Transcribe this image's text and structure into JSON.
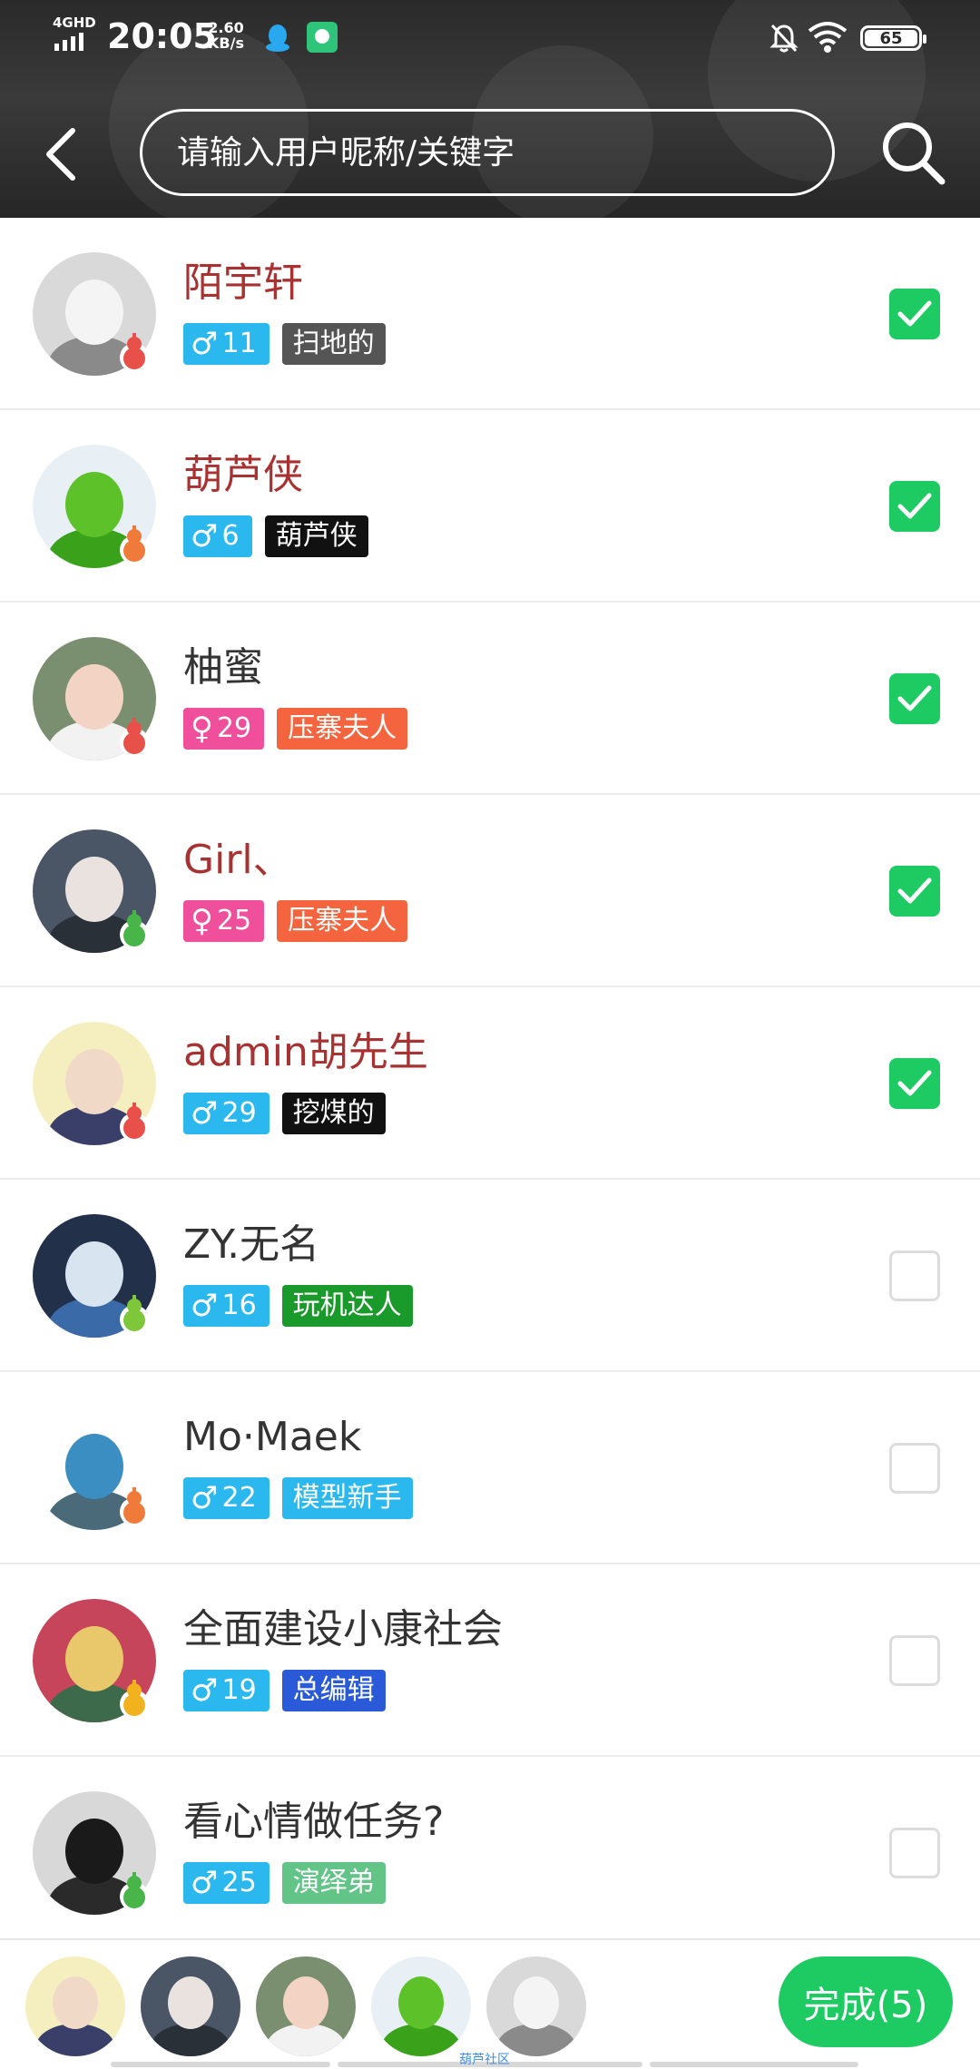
{
  "status_bar": {
    "network": "4GHD",
    "time": "20:05",
    "speed_value": "2.60",
    "speed_unit": "KB/s",
    "battery": "65",
    "icons": [
      "signal-icon",
      "qq-icon",
      "app-icon",
      "bell-muted-icon",
      "wifi-icon",
      "battery-icon"
    ]
  },
  "header": {
    "search_placeholder": "请输入用户昵称/关键字",
    "back_icon": "chevron-left-icon",
    "search_icon": "search-icon"
  },
  "colors": {
    "accent_green": "#1ecb63",
    "name_highlight": "#a83232",
    "name_normal": "#333333",
    "male_badge": "#2ab8ee",
    "female_badge": "#ef4f9b"
  },
  "users": [
    {
      "name": "陌宇轩",
      "gender": "♂",
      "age": "11",
      "title": "扫地的",
      "title_color": "#555555",
      "name_color": "#a83232",
      "checked": true,
      "gourd": "#e8504a",
      "avatar_bg": "#d9d9d9",
      "avatar_face": "#f4f4f4",
      "avatar_body": "#8a8a8a"
    },
    {
      "name": "葫芦侠",
      "gender": "♂",
      "age": "6",
      "title": "葫芦侠",
      "title_color": "#111111",
      "name_color": "#a83232",
      "checked": true,
      "gourd": "#f07a3a",
      "avatar_bg": "#e8f0f6",
      "avatar_face": "#5dc22a",
      "avatar_body": "#3aa11a"
    },
    {
      "name": "柚蜜",
      "gender": "♀",
      "age": "29",
      "title": "压寨夫人",
      "title_color": "#f4653f",
      "name_color": "#333333",
      "checked": true,
      "gourd": "#e8504a",
      "avatar_bg": "#7a8f70",
      "avatar_face": "#f3d3c4",
      "avatar_body": "#f2f2f2"
    },
    {
      "name": "Girl、",
      "gender": "♀",
      "age": "25",
      "title": "压寨夫人",
      "title_color": "#f4653f",
      "name_color": "#a83232",
      "checked": true,
      "gourd": "#48b548",
      "avatar_bg": "#4a5666",
      "avatar_face": "#e9e2df",
      "avatar_body": "#2a3038"
    },
    {
      "name": "admin胡先生",
      "gender": "♂",
      "age": "29",
      "title": "挖煤的",
      "title_color": "#111111",
      "name_color": "#a83232",
      "checked": true,
      "gourd": "#e8504a",
      "avatar_bg": "#f5efc0",
      "avatar_face": "#f1d9c8",
      "avatar_body": "#3a3f6a"
    },
    {
      "name": "ZY.无名",
      "gender": "♂",
      "age": "16",
      "title": "玩机达人",
      "title_color": "#1a9a2a",
      "name_color": "#333333",
      "checked": false,
      "gourd": "#7ec63a",
      "avatar_bg": "#22304a",
      "avatar_face": "#d8e4f0",
      "avatar_body": "#3b6aa8"
    },
    {
      "name": "Mo·Maek",
      "gender": "♂",
      "age": "22",
      "title": "模型新手",
      "title_color": "#2ab8ee",
      "name_color": "#333333",
      "checked": false,
      "gourd": "#f07a3a",
      "avatar_bg": "#ffffff",
      "avatar_face": "#3b8ec2",
      "avatar_body": "#4a6a7a"
    },
    {
      "name": "全面建设小康社会",
      "gender": "♂",
      "age": "19",
      "title": "总编辑",
      "title_color": "#2a5ad8",
      "name_color": "#333333",
      "checked": false,
      "gourd": "#f2b21e",
      "avatar_bg": "#c6455a",
      "avatar_face": "#e8c86a",
      "avatar_body": "#3d6a4a"
    },
    {
      "name": "看心情做任务?",
      "gender": "♂",
      "age": "25",
      "title": "演绎弟",
      "title_color": "#62c486",
      "name_color": "#333333",
      "checked": false,
      "gourd": "#48b548",
      "avatar_bg": "#d8d8d8",
      "avatar_face": "#1a1a1a",
      "avatar_body": "#2a2a2a"
    }
  ],
  "selected": [
    {
      "avatar_bg": "#f5efc0",
      "avatar_face": "#f1d9c8",
      "avatar_body": "#3a3f6a"
    },
    {
      "avatar_bg": "#4a5666",
      "avatar_face": "#e9e2df",
      "avatar_body": "#2a3038"
    },
    {
      "avatar_bg": "#7a8f70",
      "avatar_face": "#f3d3c4",
      "avatar_body": "#f2f2f2"
    },
    {
      "avatar_bg": "#e8f0f6",
      "avatar_face": "#5dc22a",
      "avatar_body": "#3aa11a"
    },
    {
      "avatar_bg": "#d9d9d9",
      "avatar_face": "#f4f4f4",
      "avatar_body": "#8a8a8a"
    }
  ],
  "done_button": "完成(5)",
  "nav_label": "葫芦社区"
}
